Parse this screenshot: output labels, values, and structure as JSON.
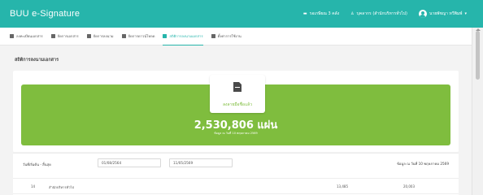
{
  "app": {
    "title": "BUU e-Signature"
  },
  "top": {
    "pending": "รอเกษียณ 3 คลัง",
    "department": "บุคลากร (สำนักบริหารทั่วไป)",
    "user": "นายพัชญา ทวีพิมพ์"
  },
  "nav": {
    "items": [
      {
        "label": "ลงทะเบียนเอกสาร"
      },
      {
        "label": "จัดการเอกสาร"
      },
      {
        "label": "จัดการลงนาม"
      },
      {
        "label": "จัดการดาวน์โหลด"
      },
      {
        "label": "สถิติการลงนามเอกสาร"
      },
      {
        "label": "ตั้งค่าการใช้งาน"
      }
    ]
  },
  "page": {
    "title": "สถิติการลงนามเอกสาร"
  },
  "stats": {
    "label": "ลงลายมือชื่อแล้ว",
    "count": "2,530,806 แผ่น",
    "note": "ข้อมูล ณ วันที่ 10 พฤษภาคม 2569"
  },
  "filter": {
    "label": "วันที่เริ่มต้น - สิ้นสุด",
    "start_date": "01/08/2564",
    "end_date": "11/05/2569",
    "data_note": "ข้อมูล ณ วันที่ 10 พฤษภาคม 2569"
  },
  "table": {
    "rows": [
      {
        "no": "14",
        "unit": "สำนักบริหารทั่วไป",
        "value1": "13,485",
        "value2": "20,003"
      }
    ]
  }
}
